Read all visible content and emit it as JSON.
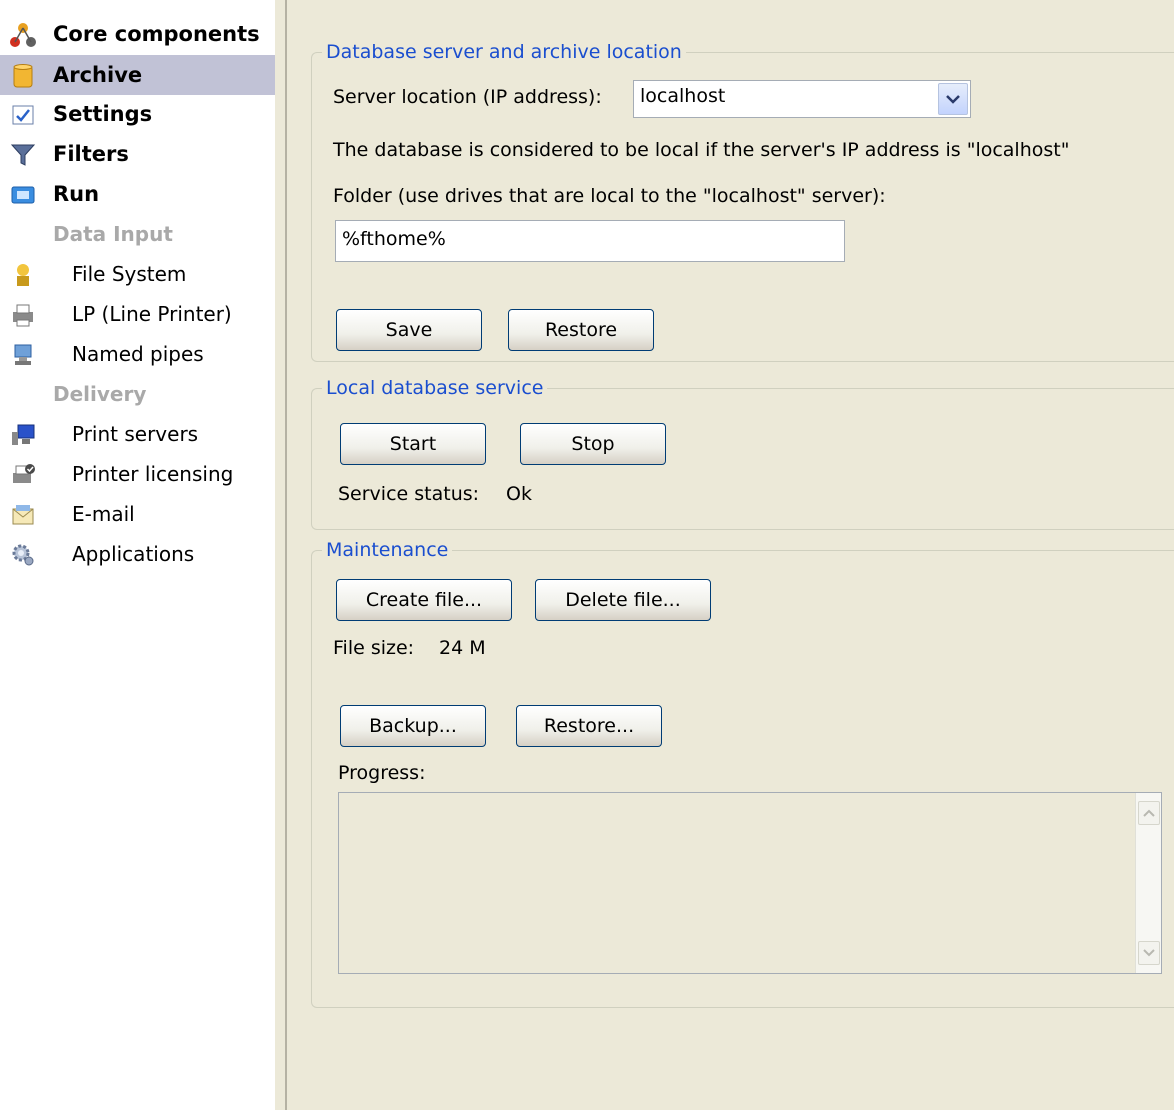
{
  "sidebar": {
    "items": [
      {
        "label": "Core components",
        "icon": "core-components-icon"
      },
      {
        "label": "Archive",
        "icon": "archive-icon"
      },
      {
        "label": "Settings",
        "icon": "settings-icon"
      },
      {
        "label": "Filters",
        "icon": "filter-icon"
      },
      {
        "label": "Run",
        "icon": "run-icon"
      }
    ],
    "data_input_heading": "Data Input",
    "data_input_items": [
      {
        "label": "File System",
        "icon": "file-system-icon"
      },
      {
        "label": "LP (Line Printer)",
        "icon": "line-printer-icon"
      },
      {
        "label": "Named pipes",
        "icon": "named-pipes-icon"
      }
    ],
    "delivery_heading": "Delivery",
    "delivery_items": [
      {
        "label": "Print servers",
        "icon": "print-server-icon"
      },
      {
        "label": "Printer licensing",
        "icon": "printer-licensing-icon"
      },
      {
        "label": "E-mail",
        "icon": "email-icon"
      },
      {
        "label": "Applications",
        "icon": "applications-icon"
      }
    ],
    "selected": "Archive"
  },
  "db_group": {
    "title": "Database server and archive location",
    "server_label": "Server location (IP address):",
    "server_value": "localhost",
    "info_text": "The database is considered to be local if the server's IP address is \"localhost\"",
    "folder_label": "Folder (use drives that are local to the \"localhost\" server):",
    "folder_value": "%fthome%",
    "save_label": "Save",
    "restore_label": "Restore"
  },
  "service_group": {
    "title": "Local database service",
    "start_label": "Start",
    "stop_label": "Stop",
    "status_label": "Service status:",
    "status_value": "Ok"
  },
  "maint_group": {
    "title": "Maintenance",
    "create_label": "Create file...",
    "delete_label": "Delete file...",
    "size_label": "File size:",
    "size_value": "24 M",
    "backup_label": "Backup...",
    "restore_label": "Restore...",
    "progress_label": "Progress:"
  },
  "colors": {
    "accent": "#1a4ecf",
    "selected_bg": "#c1c2d6",
    "panel_bg": "#ece9d8"
  }
}
